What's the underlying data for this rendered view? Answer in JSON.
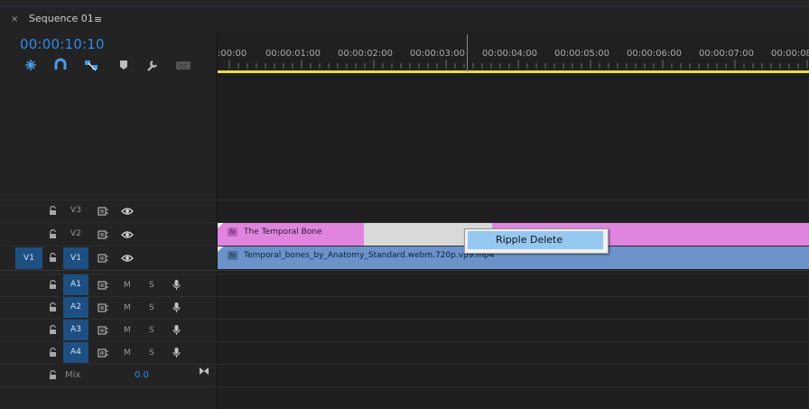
{
  "tab": {
    "close_glyph": "×",
    "title": "Sequence 01",
    "menu_glyph": "≡"
  },
  "timecode": "00:00:10:10",
  "toolbar": {
    "icons": [
      "insert-sequence-as-nest-icon",
      "snap-magnet-icon",
      "linked-selection-icon",
      "add-marker-icon",
      "wrench-icon",
      "captions-icon"
    ]
  },
  "ruler": {
    "labels": [
      ":00:00",
      "00:00:01:00",
      "00:00:02:00",
      "00:00:03:00",
      "00:00:04:00",
      "00:00:05:00",
      "00:00:06:00",
      "00:00:07:00",
      "00:00:08"
    ]
  },
  "tracks": {
    "v3": {
      "label": "V3"
    },
    "v2": {
      "label": "V2"
    },
    "v1": {
      "source": "V1",
      "label": "V1"
    },
    "a1": {
      "label": "A1",
      "mute": "M",
      "solo": "S"
    },
    "a2": {
      "label": "A2",
      "mute": "M",
      "solo": "S"
    },
    "a3": {
      "label": "A3",
      "mute": "M",
      "solo": "S"
    },
    "a4": {
      "label": "A4",
      "mute": "M",
      "solo": "S"
    },
    "mix": {
      "label": "Mix",
      "value": "0.0"
    }
  },
  "clips": {
    "v2_title": "The Temporal Bone",
    "v1_video": "Temporal_bones_by_Anatomy_Standard.webm.720p.vp9.mp4",
    "fx_badge": "fx"
  },
  "context_menu": {
    "item": "Ripple Delete"
  },
  "colors": {
    "accent": "#2d8ceb",
    "playhead_bar": "#e8df3a",
    "title_clip": "#e184e0",
    "video_clip": "#6b93c9",
    "menu_highlight": "#95c8f1"
  }
}
